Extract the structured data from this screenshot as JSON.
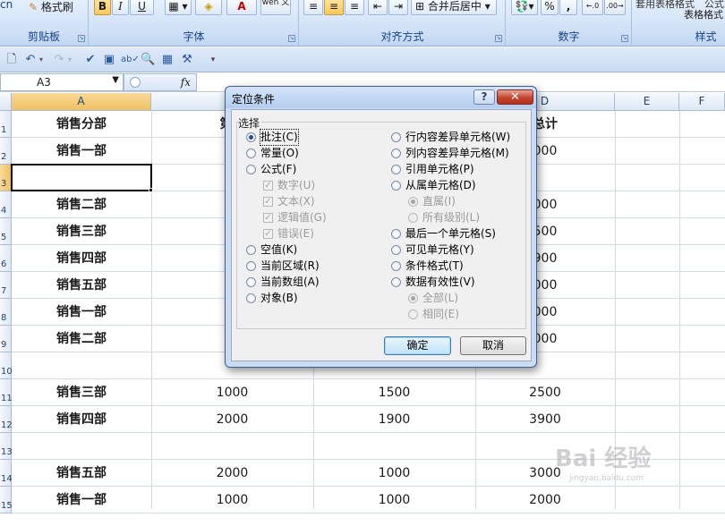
{
  "ribbon": {
    "groups": [
      {
        "label": "剪贴板"
      },
      {
        "label": "字体"
      },
      {
        "label": "对齐方式"
      },
      {
        "label": "数字"
      },
      {
        "label": "样式"
      }
    ],
    "format_painter": "格式刷",
    "cut_fragment": "cn",
    "bold": "B",
    "italic": "I",
    "underline": "U",
    "font_color_glyph": "A",
    "wen": "wén\n文",
    "merge_center": "合并后居中",
    "percent": "%",
    "comma": ",",
    "dec_inc": ".00 →.0",
    "dec_dec": ".0 →.00",
    "style_text1": "套用表格格式",
    "style_text2": "表格格式",
    "style_text3": "公式"
  },
  "formula_bar": {
    "name_box": "A3",
    "fx": "fx"
  },
  "grid": {
    "columns": [
      "A",
      "B",
      "C",
      "D",
      "E",
      "F"
    ],
    "rows": [
      {
        "num": "1",
        "a": "销售分部",
        "b": "第一",
        "c": "",
        "d": "总计"
      },
      {
        "num": "2",
        "a": "销售一部",
        "b": "1",
        "c": "",
        "d": "000"
      },
      {
        "num": "3",
        "a": "",
        "b": "",
        "c": "",
        "d": ""
      },
      {
        "num": "4",
        "a": "销售二部",
        "b": "2",
        "c": "",
        "d": "000"
      },
      {
        "num": "5",
        "a": "销售三部",
        "b": "1",
        "c": "",
        "d": "500"
      },
      {
        "num": "6",
        "a": "销售四部",
        "b": "2",
        "c": "",
        "d": "900"
      },
      {
        "num": "7",
        "a": "销售五部",
        "b": "2",
        "c": "",
        "d": "000"
      },
      {
        "num": "8",
        "a": "销售一部",
        "b": "1",
        "c": "",
        "d": "000"
      },
      {
        "num": "9",
        "a": "销售二部",
        "b": "2",
        "c": "",
        "d": "000"
      },
      {
        "num": "10",
        "a": "",
        "b": "",
        "c": "",
        "d": ""
      },
      {
        "num": "11",
        "a": "销售三部",
        "b": "1000",
        "c": "1500",
        "d": "2500"
      },
      {
        "num": "12",
        "a": "销售四部",
        "b": "2000",
        "c": "1900",
        "d": "3900"
      },
      {
        "num": "13",
        "a": "",
        "b": "",
        "c": "",
        "d": ""
      },
      {
        "num": "14",
        "a": "销售五部",
        "b": "2000",
        "c": "1000",
        "d": "3000"
      },
      {
        "num": "15",
        "a": "销售一部",
        "b": "1000",
        "c": "1000",
        "d": "2000"
      }
    ]
  },
  "dialog": {
    "title": "定位条件",
    "help": "?",
    "close": "✕",
    "group_label": "选择",
    "left_options": [
      {
        "label": "批注(C)",
        "selected": true
      },
      {
        "label": "常量(O)",
        "selected": false
      },
      {
        "label": "公式(F)",
        "selected": false
      },
      {
        "label": "数字(U)",
        "checked": true
      },
      {
        "label": "文本(X)",
        "checked": true
      },
      {
        "label": "逻辑值(G)",
        "checked": true
      },
      {
        "label": "错误(E)",
        "checked": true
      },
      {
        "label": "空值(K)",
        "selected": false
      },
      {
        "label": "当前区域(R)",
        "selected": false
      },
      {
        "label": "当前数组(A)",
        "selected": false
      },
      {
        "label": "对象(B)",
        "selected": false
      }
    ],
    "right_options": [
      {
        "label": "行内容差异单元格(W)",
        "selected": false
      },
      {
        "label": "列内容差异单元格(M)",
        "selected": false
      },
      {
        "label": "引用单元格(P)",
        "selected": false
      },
      {
        "label": "从属单元格(D)",
        "selected": false
      },
      {
        "label": "直属(I)",
        "selected": true
      },
      {
        "label": "所有级别(L)",
        "selected": false
      },
      {
        "label": "最后一个单元格(S)",
        "selected": false
      },
      {
        "label": "可见单元格(Y)",
        "selected": false
      },
      {
        "label": "条件格式(T)",
        "selected": false
      },
      {
        "label": "数据有效性(V)",
        "selected": false
      },
      {
        "label": "全部(L)",
        "selected": true
      },
      {
        "label": "相同(E)",
        "selected": false
      }
    ],
    "ok": "确定",
    "cancel": "取消"
  },
  "watermark": {
    "brand": "Bai 经验",
    "url": "jingyan.baidu.com"
  }
}
